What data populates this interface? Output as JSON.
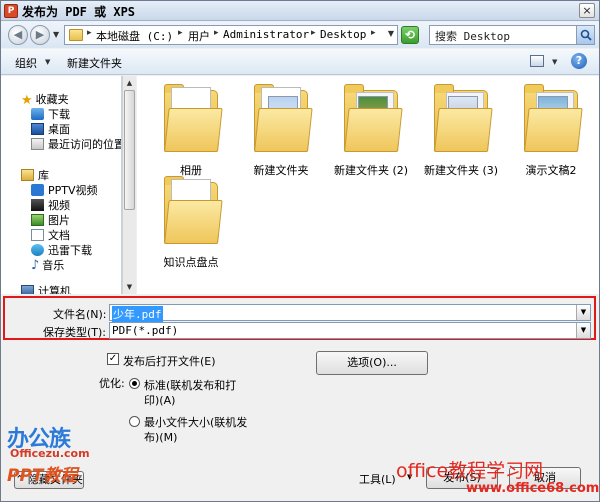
{
  "window": {
    "title": "发布为 PDF 或 XPS",
    "close_label": "×"
  },
  "address": {
    "crumbs": [
      "本地磁盘 (C:)",
      "用户",
      "Administrator",
      "Desktop"
    ],
    "search_placeholder": "搜索 Desktop"
  },
  "toolbar": {
    "organize": "组织",
    "new_folder": "新建文件夹",
    "help": "?"
  },
  "nav": {
    "favorites": "收藏夹",
    "downloads": "下载",
    "desktop": "桌面",
    "recent": "最近访问的位置",
    "libraries": "库",
    "pptv": "PPTV视频",
    "videos": "视频",
    "pictures": "图片",
    "documents": "文档",
    "xunlei": "迅雷下载",
    "music": "音乐",
    "computer": "计算机"
  },
  "files": [
    {
      "name": "相册"
    },
    {
      "name": "新建文件夹"
    },
    {
      "name": "新建文件夹 (2)"
    },
    {
      "name": "新建文件夹 (3)"
    },
    {
      "name": "演示文稿2"
    },
    {
      "name": "知识点盘点"
    }
  ],
  "form": {
    "filename_label": "文件名(N):",
    "filename_value": "少年.pdf",
    "savetype_label": "保存类型(T):",
    "savetype_value": "PDF(*.pdf)",
    "open_after_label": "发布后打开文件(E)",
    "open_after_checked": true,
    "options_button": "选项(O)...",
    "optimize_label": "优化:",
    "opt_standard_line1": "标准(联机发布和打",
    "opt_standard_line2": "印)(A)",
    "opt_min_line1": "最小文件大小(联机发",
    "opt_min_line2": "布)(M)"
  },
  "footer": {
    "hide_folders": "隐藏文件夹",
    "tools": "工具(L)",
    "publish": "发布(S)",
    "cancel": "取消"
  },
  "watermarks": {
    "site_name": "办公族",
    "site_domain": "Officezu.com",
    "ppt": "PPT教程",
    "office_cn": "office教程学习网",
    "office_url": "www.office68.com"
  }
}
